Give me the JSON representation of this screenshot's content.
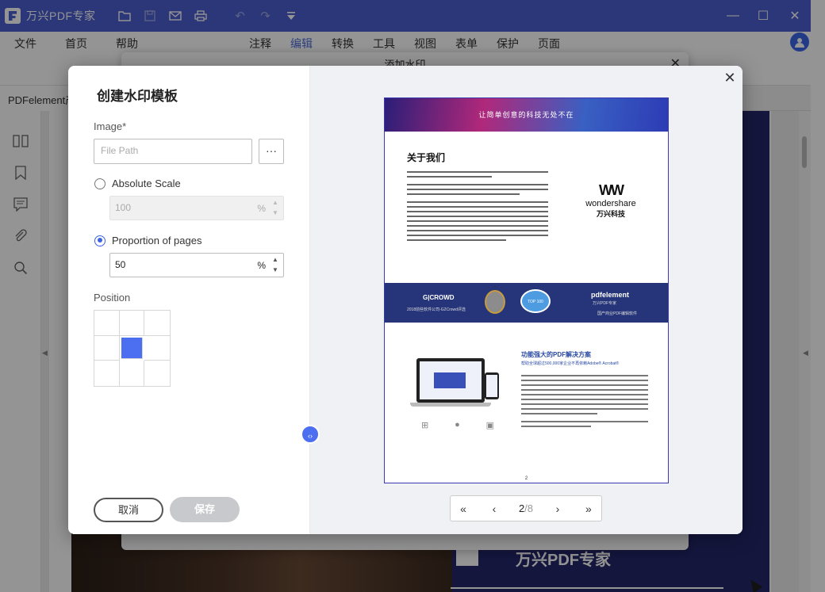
{
  "app": {
    "title": "万兴PDF专家",
    "toolbar_icons": [
      "folder-icon",
      "save-icon",
      "mail-icon",
      "print-icon",
      "undo-icon",
      "redo-icon",
      "dropdown-icon"
    ],
    "window_controls": [
      "minimize-icon",
      "maximize-icon",
      "close-icon"
    ]
  },
  "menu": {
    "file": "文件",
    "home": "首页",
    "help": "帮助",
    "comment": "注释",
    "edit": "编辑",
    "convert": "转换",
    "tools": "工具",
    "view": "视图",
    "form": "表单",
    "protect": "保护",
    "page": "页面",
    "active": "编辑"
  },
  "doc_tab": {
    "label": "PDFelement产"
  },
  "sidebar": {
    "icons": [
      "thumbnails-icon",
      "bookmark-icon",
      "comment-icon",
      "attachment-icon",
      "search-icon"
    ]
  },
  "background_doc": {
    "brand": "万兴PDF专家"
  },
  "back_dialog": {
    "title": "添加水印"
  },
  "dialog": {
    "title": "创建水印模板",
    "image_label": "Image*",
    "file_path_placeholder": "File Path",
    "browse_label": "···",
    "absolute_scale_label": "Absolute Scale",
    "absolute_scale_value": "100",
    "absolute_scale_unit": "%",
    "absolute_scale_selected": false,
    "proportion_label": "Proportion of pages",
    "proportion_value": "50",
    "proportion_unit": "%",
    "proportion_selected": true,
    "position_label": "Position",
    "position_selected_cell": 4,
    "cancel_label": "取消",
    "save_label": "保存",
    "accent_color": "#4c6ef0"
  },
  "preview": {
    "banner_text": "让简单创意的科技无处不在",
    "heading": "关于我们",
    "logo_name": "wondershare",
    "logo_cn": "万兴科技",
    "band_g2": "G|CROWD",
    "band_g2_sub": "2018前些软件公司-G2Crowd评选",
    "band_top": "TOP 100",
    "band_pdfelement": "pdfelement",
    "band_pdfelement_sub": "万兴PDF专家",
    "band_pdfelement_sub2": "国产商业PDF编辑软件",
    "section_heading": "功能强大的PDF解决方案",
    "section_sub": "帮助全球超过500,000家企业不再依赖Adobe® Acrobat®",
    "page_number": "2"
  },
  "pager": {
    "first": "«",
    "prev": "‹",
    "current": "2",
    "total": "/8",
    "next": "›",
    "last": "»"
  }
}
